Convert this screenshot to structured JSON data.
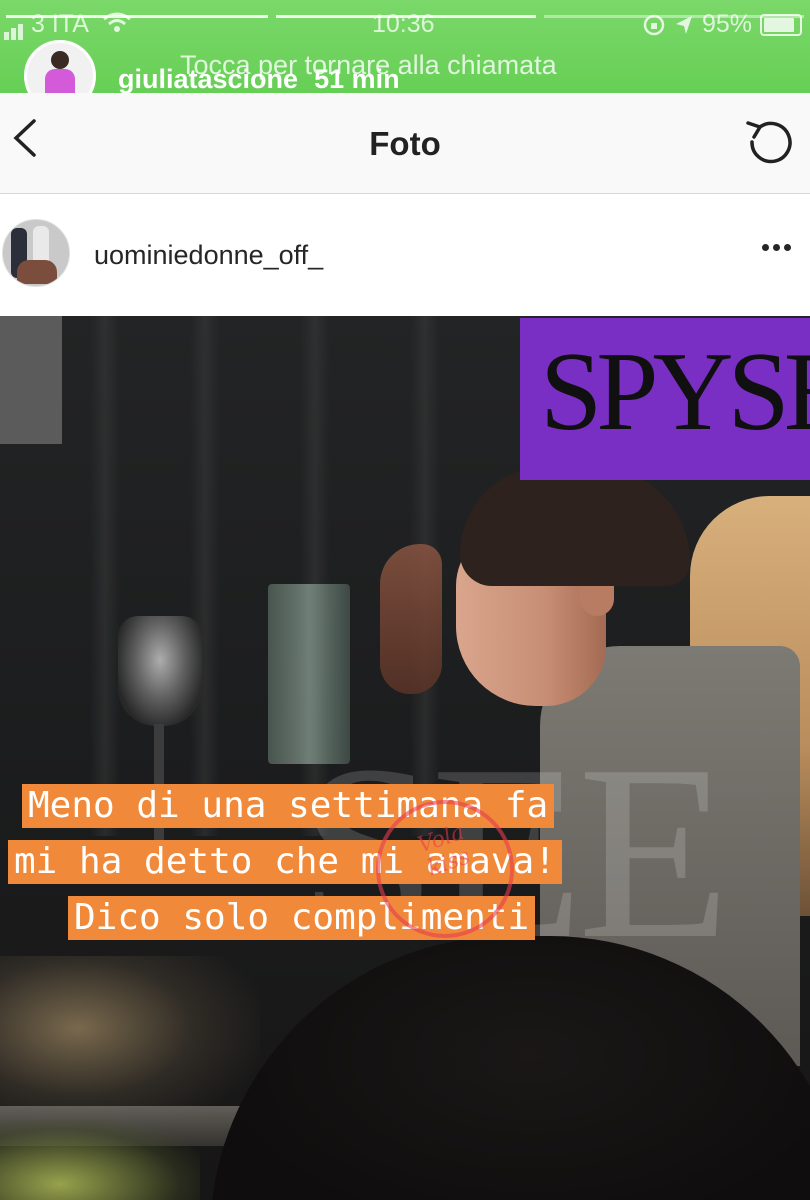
{
  "status_bar": {
    "carrier": "3 ITA",
    "time": "10:36",
    "battery": "95%",
    "call_banner": "Tocca per tornare alla chiamata"
  },
  "story": {
    "username": "giuliatascione",
    "time_ago": "51 min",
    "progress_segments": 3
  },
  "nav": {
    "title": "Foto",
    "back_icon": "chevron-left-icon",
    "refresh_icon": "refresh-icon"
  },
  "post": {
    "username": "uominiedonne_off_",
    "more_icon": "more-horizontal-icon"
  },
  "photo": {
    "logo_text": "SPYSEE",
    "watermark_text": "SEE",
    "stamp_text": "Vola kiss",
    "caption_lines": [
      "Meno di una settimana fa",
      "mi ha detto che mi amava!",
      "Dico solo complimenti"
    ]
  },
  "colors": {
    "story_green": "#66cf55",
    "caption_orange": "#f08a3a",
    "logo_purple": "#7a2fc4"
  }
}
